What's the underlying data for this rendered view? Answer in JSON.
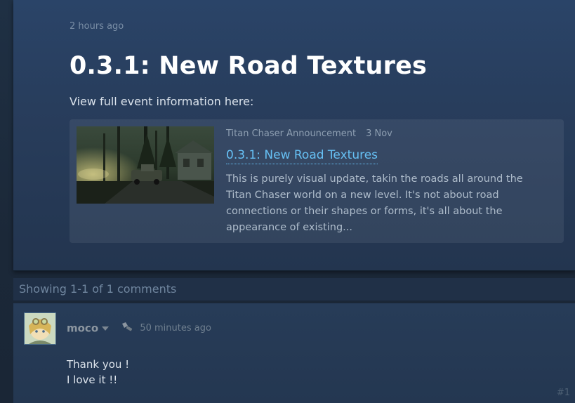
{
  "post": {
    "timestamp": "2 hours ago",
    "title": "0.3.1: New Road Textures",
    "view_info": "View full event information here:"
  },
  "event_card": {
    "source": "Titan Chaser Announcement",
    "date": "3 Nov",
    "title": "0.3.1: New Road Textures",
    "description": "This is purely visual update, takin the roads all around the Titan Chaser world on a new level. It's not about road connections or their shapes or forms, it's all about the appearance of existing..."
  },
  "comments": {
    "header": "Showing 1-1 of 1 comments",
    "items": [
      {
        "author": "moco",
        "time": "50 minutes ago",
        "line1": "Thank you !",
        "line2": "I love it !!",
        "number": "#1"
      }
    ]
  },
  "colors": {
    "accent_link": "#66c0f4",
    "panel": "#283d5c",
    "page_bg": "#1b2838"
  },
  "icons": {
    "dropdown": "chevron-down-icon",
    "badge": "developer-badge-icon"
  }
}
